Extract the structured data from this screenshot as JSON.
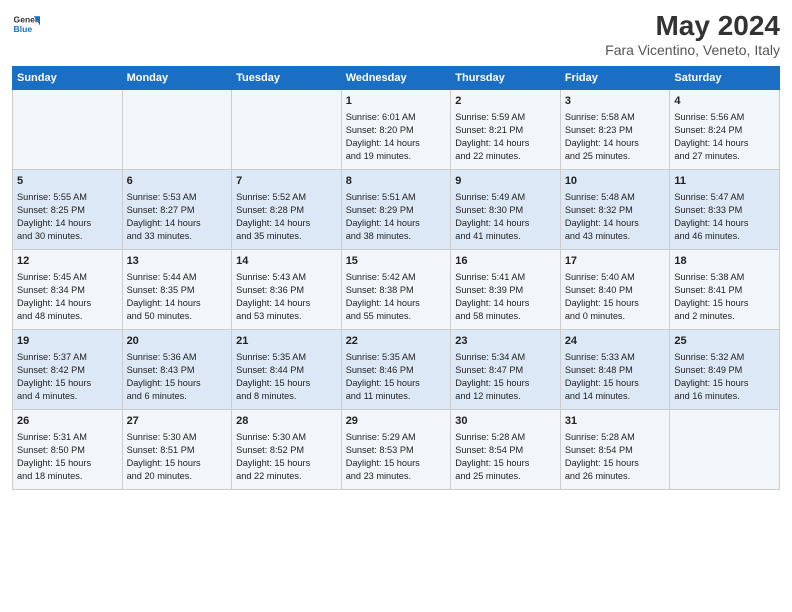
{
  "header": {
    "logo_line1": "General",
    "logo_line2": "Blue",
    "month": "May 2024",
    "location": "Fara Vicentino, Veneto, Italy"
  },
  "days_of_week": [
    "Sunday",
    "Monday",
    "Tuesday",
    "Wednesday",
    "Thursday",
    "Friday",
    "Saturday"
  ],
  "weeks": [
    [
      {
        "day": "",
        "info": ""
      },
      {
        "day": "",
        "info": ""
      },
      {
        "day": "",
        "info": ""
      },
      {
        "day": "1",
        "info": "Sunrise: 6:01 AM\nSunset: 8:20 PM\nDaylight: 14 hours\nand 19 minutes."
      },
      {
        "day": "2",
        "info": "Sunrise: 5:59 AM\nSunset: 8:21 PM\nDaylight: 14 hours\nand 22 minutes."
      },
      {
        "day": "3",
        "info": "Sunrise: 5:58 AM\nSunset: 8:23 PM\nDaylight: 14 hours\nand 25 minutes."
      },
      {
        "day": "4",
        "info": "Sunrise: 5:56 AM\nSunset: 8:24 PM\nDaylight: 14 hours\nand 27 minutes."
      }
    ],
    [
      {
        "day": "5",
        "info": "Sunrise: 5:55 AM\nSunset: 8:25 PM\nDaylight: 14 hours\nand 30 minutes."
      },
      {
        "day": "6",
        "info": "Sunrise: 5:53 AM\nSunset: 8:27 PM\nDaylight: 14 hours\nand 33 minutes."
      },
      {
        "day": "7",
        "info": "Sunrise: 5:52 AM\nSunset: 8:28 PM\nDaylight: 14 hours\nand 35 minutes."
      },
      {
        "day": "8",
        "info": "Sunrise: 5:51 AM\nSunset: 8:29 PM\nDaylight: 14 hours\nand 38 minutes."
      },
      {
        "day": "9",
        "info": "Sunrise: 5:49 AM\nSunset: 8:30 PM\nDaylight: 14 hours\nand 41 minutes."
      },
      {
        "day": "10",
        "info": "Sunrise: 5:48 AM\nSunset: 8:32 PM\nDaylight: 14 hours\nand 43 minutes."
      },
      {
        "day": "11",
        "info": "Sunrise: 5:47 AM\nSunset: 8:33 PM\nDaylight: 14 hours\nand 46 minutes."
      }
    ],
    [
      {
        "day": "12",
        "info": "Sunrise: 5:45 AM\nSunset: 8:34 PM\nDaylight: 14 hours\nand 48 minutes."
      },
      {
        "day": "13",
        "info": "Sunrise: 5:44 AM\nSunset: 8:35 PM\nDaylight: 14 hours\nand 50 minutes."
      },
      {
        "day": "14",
        "info": "Sunrise: 5:43 AM\nSunset: 8:36 PM\nDaylight: 14 hours\nand 53 minutes."
      },
      {
        "day": "15",
        "info": "Sunrise: 5:42 AM\nSunset: 8:38 PM\nDaylight: 14 hours\nand 55 minutes."
      },
      {
        "day": "16",
        "info": "Sunrise: 5:41 AM\nSunset: 8:39 PM\nDaylight: 14 hours\nand 58 minutes."
      },
      {
        "day": "17",
        "info": "Sunrise: 5:40 AM\nSunset: 8:40 PM\nDaylight: 15 hours\nand 0 minutes."
      },
      {
        "day": "18",
        "info": "Sunrise: 5:38 AM\nSunset: 8:41 PM\nDaylight: 15 hours\nand 2 minutes."
      }
    ],
    [
      {
        "day": "19",
        "info": "Sunrise: 5:37 AM\nSunset: 8:42 PM\nDaylight: 15 hours\nand 4 minutes."
      },
      {
        "day": "20",
        "info": "Sunrise: 5:36 AM\nSunset: 8:43 PM\nDaylight: 15 hours\nand 6 minutes."
      },
      {
        "day": "21",
        "info": "Sunrise: 5:35 AM\nSunset: 8:44 PM\nDaylight: 15 hours\nand 8 minutes."
      },
      {
        "day": "22",
        "info": "Sunrise: 5:35 AM\nSunset: 8:46 PM\nDaylight: 15 hours\nand 11 minutes."
      },
      {
        "day": "23",
        "info": "Sunrise: 5:34 AM\nSunset: 8:47 PM\nDaylight: 15 hours\nand 12 minutes."
      },
      {
        "day": "24",
        "info": "Sunrise: 5:33 AM\nSunset: 8:48 PM\nDaylight: 15 hours\nand 14 minutes."
      },
      {
        "day": "25",
        "info": "Sunrise: 5:32 AM\nSunset: 8:49 PM\nDaylight: 15 hours\nand 16 minutes."
      }
    ],
    [
      {
        "day": "26",
        "info": "Sunrise: 5:31 AM\nSunset: 8:50 PM\nDaylight: 15 hours\nand 18 minutes."
      },
      {
        "day": "27",
        "info": "Sunrise: 5:30 AM\nSunset: 8:51 PM\nDaylight: 15 hours\nand 20 minutes."
      },
      {
        "day": "28",
        "info": "Sunrise: 5:30 AM\nSunset: 8:52 PM\nDaylight: 15 hours\nand 22 minutes."
      },
      {
        "day": "29",
        "info": "Sunrise: 5:29 AM\nSunset: 8:53 PM\nDaylight: 15 hours\nand 23 minutes."
      },
      {
        "day": "30",
        "info": "Sunrise: 5:28 AM\nSunset: 8:54 PM\nDaylight: 15 hours\nand 25 minutes."
      },
      {
        "day": "31",
        "info": "Sunrise: 5:28 AM\nSunset: 8:54 PM\nDaylight: 15 hours\nand 26 minutes."
      },
      {
        "day": "",
        "info": ""
      }
    ]
  ]
}
